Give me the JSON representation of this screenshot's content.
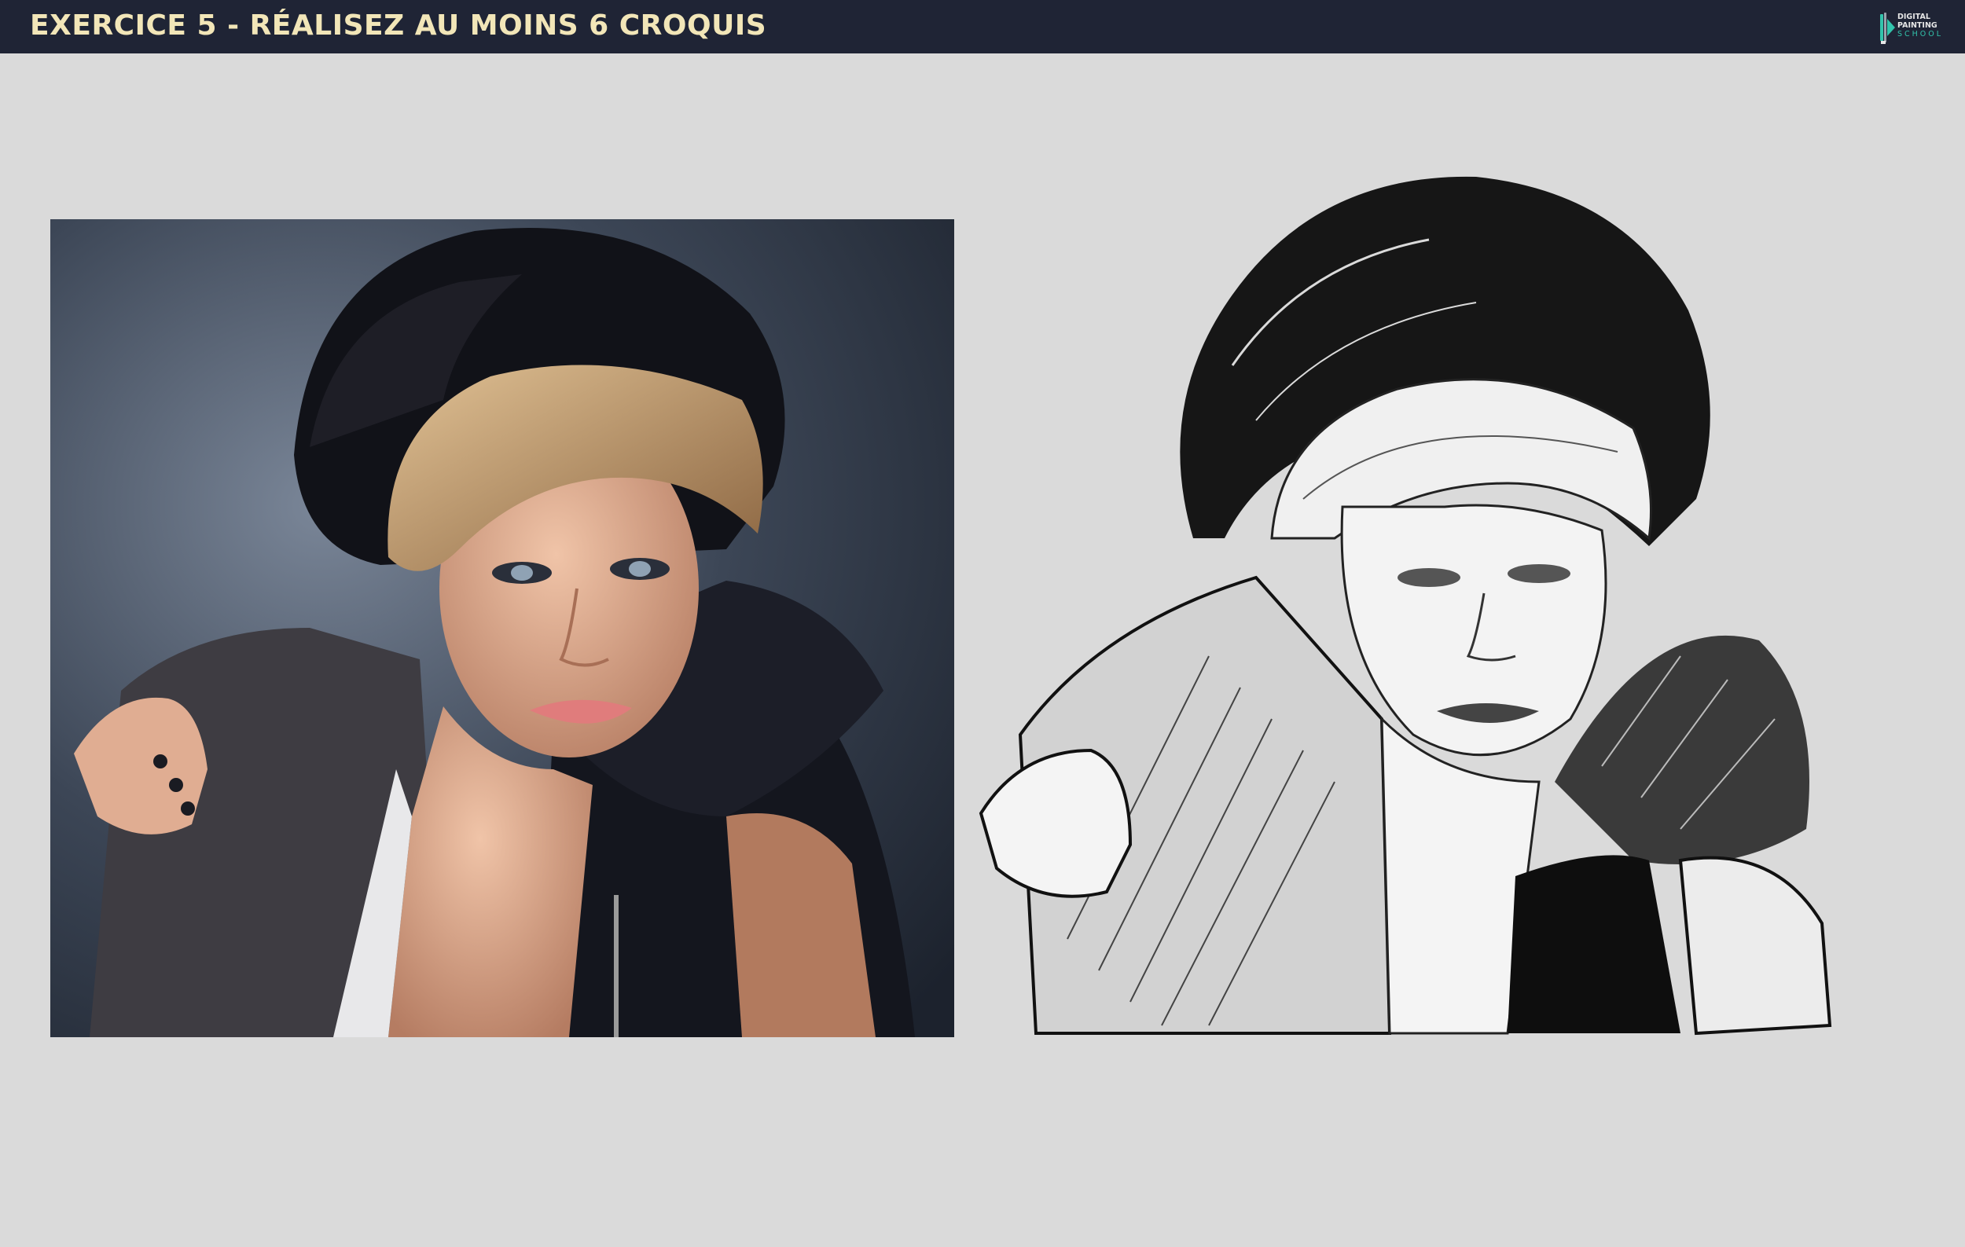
{
  "header": {
    "title": "EXERCICE 5 - RÉALISEZ AU MOINS 6 CROQUIS",
    "logo": {
      "lines": [
        "DIGITAL",
        "PAINTING",
        "SCHOOL"
      ],
      "icon": "paintbrush-play-logo",
      "colors": {
        "text": "#e6e6e6",
        "accent": "#32c4ac"
      }
    }
  },
  "reference_photo": {
    "subject": "woman-in-fur-hat-and-fur-coat-portrait"
  },
  "sketch": {
    "subject": "black-and-white-digital-sketch-of-reference"
  },
  "colors": {
    "header_bg": "#1f2435",
    "title": "#f2e6b8",
    "page_bg": "#dadada"
  }
}
